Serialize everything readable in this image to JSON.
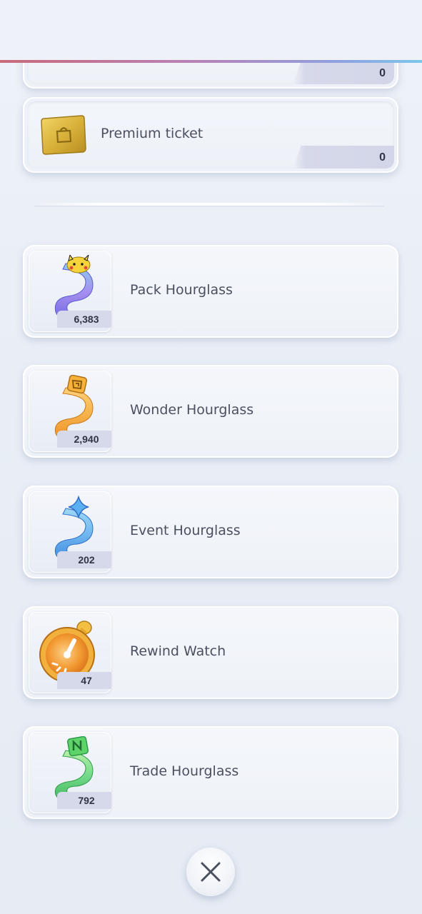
{
  "top_card": {
    "count": "0"
  },
  "premium_ticket": {
    "label": "Premium ticket",
    "count": "0"
  },
  "items": [
    {
      "label": "Pack Hourglass",
      "count": "6,383",
      "icon": "pack-hourglass-icon"
    },
    {
      "label": "Wonder Hourglass",
      "count": "2,940",
      "icon": "wonder-hourglass-icon"
    },
    {
      "label": "Event Hourglass",
      "count": "202",
      "icon": "event-hourglass-icon"
    },
    {
      "label": "Rewind Watch",
      "count": "47",
      "icon": "rewind-watch-icon"
    },
    {
      "label": "Trade Hourglass",
      "count": "792",
      "icon": "trade-hourglass-icon"
    }
  ],
  "close": {
    "icon": "close-icon"
  },
  "colors": {
    "top_line_start": "#c96a7a",
    "top_line_end": "#7cc7ea",
    "pack": "#9a8ee8",
    "wonder": "#f2a93b",
    "event": "#5b9fe8",
    "rewind": "#f08a2a",
    "trade": "#4fc267"
  }
}
